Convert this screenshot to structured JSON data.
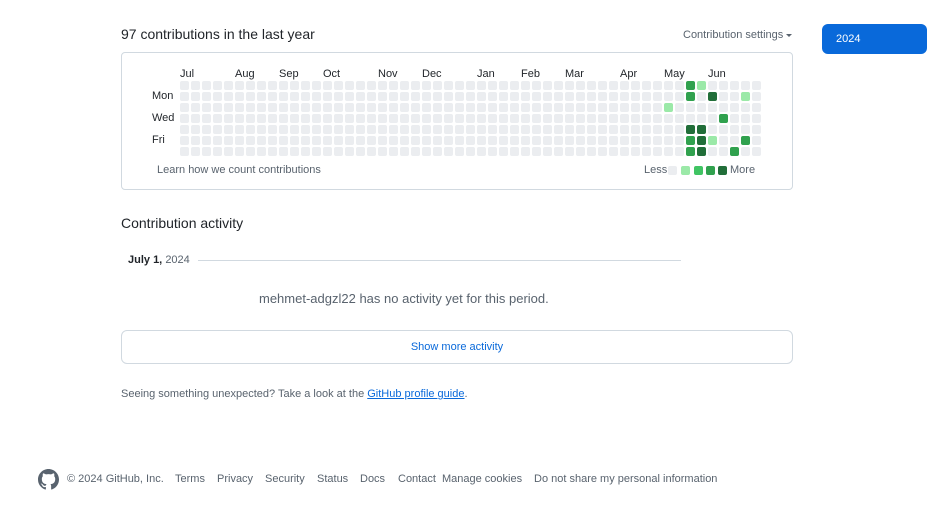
{
  "header": {
    "title": "97 contributions in the last year",
    "settings_label": "Contribution settings",
    "year_button": "2024"
  },
  "graph": {
    "months": [
      "Jul",
      "Aug",
      "Sep",
      "Oct",
      "Nov",
      "Dec",
      "Jan",
      "Feb",
      "Mar",
      "Apr",
      "May",
      "Jun"
    ],
    "days": [
      "Mon",
      "Wed",
      "Fri"
    ],
    "learn_link": "Learn how we count contributions",
    "legend_less": "Less",
    "legend_more": "More",
    "level_colors": [
      "#ebedf0",
      "#9be9a8",
      "#40c463",
      "#30a14e",
      "#216e39"
    ],
    "weeks": 53,
    "active_cells": [
      {
        "week": 46,
        "day": 0,
        "level": 3
      },
      {
        "week": 47,
        "day": 0,
        "level": 1
      },
      {
        "week": 46,
        "day": 1,
        "level": 3
      },
      {
        "week": 48,
        "day": 1,
        "level": 4
      },
      {
        "week": 51,
        "day": 1,
        "level": 1
      },
      {
        "week": 44,
        "day": 2,
        "level": 1
      },
      {
        "week": 49,
        "day": 3,
        "level": 3
      },
      {
        "week": 46,
        "day": 4,
        "level": 4
      },
      {
        "week": 47,
        "day": 4,
        "level": 4
      },
      {
        "week": 46,
        "day": 5,
        "level": 3
      },
      {
        "week": 47,
        "day": 5,
        "level": 4
      },
      {
        "week": 48,
        "day": 5,
        "level": 1
      },
      {
        "week": 51,
        "day": 5,
        "level": 3
      },
      {
        "week": 46,
        "day": 6,
        "level": 3
      },
      {
        "week": 47,
        "day": 6,
        "level": 4
      },
      {
        "week": 50,
        "day": 6,
        "level": 3
      }
    ]
  },
  "activity": {
    "title": "Contribution activity",
    "date_month_day": "July 1,",
    "date_year": "2024",
    "no_activity": "mehmet-adgzl22 has no activity yet for this period.",
    "show_more": "Show more activity",
    "unexpected_prefix": "Seeing something unexpected? Take a look at the ",
    "guide_link": "GitHub profile guide",
    "unexpected_suffix": "."
  },
  "footer": {
    "copyright": "© 2024 GitHub, Inc.",
    "links": [
      "Terms",
      "Privacy",
      "Security",
      "Status",
      "Docs",
      "Contact",
      "Manage cookies",
      "Do not share my personal information"
    ]
  }
}
